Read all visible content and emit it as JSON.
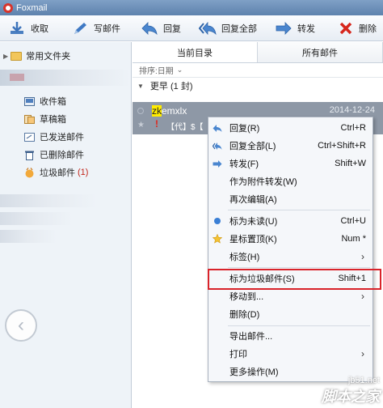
{
  "app": {
    "title": "Foxmail"
  },
  "toolbar": {
    "receive": "收取",
    "compose": "写邮件",
    "reply": "回复",
    "reply_all": "回复全部",
    "forward": "转发",
    "delete": "删除"
  },
  "sidebar": {
    "group_label": "常用文件夹",
    "items": [
      {
        "label": "收件箱",
        "icon": "inbox-icon",
        "count": ""
      },
      {
        "label": "草稿箱",
        "icon": "drafts-icon",
        "count": ""
      },
      {
        "label": "已发送邮件",
        "icon": "sent-icon",
        "count": ""
      },
      {
        "label": "已删除邮件",
        "icon": "trash-icon",
        "count": ""
      },
      {
        "label": "垃圾邮件",
        "icon": "junk-icon",
        "count": "(1)"
      }
    ]
  },
  "main": {
    "tabs": [
      {
        "label": "当前目录"
      },
      {
        "label": "所有邮件"
      }
    ],
    "sort_label": "排序:日期",
    "group_label": "更早 (1 封)",
    "mail": {
      "from_highlight": "zk",
      "from_rest": "emxlx",
      "date": "2014-12-24",
      "subject": "【代】$【"
    }
  },
  "context_menu": {
    "items": [
      {
        "label": "回复(R)",
        "shortcut": "Ctrl+R"
      },
      {
        "label": "回复全部(L)",
        "shortcut": "Ctrl+Shift+R"
      },
      {
        "label": "转发(F)",
        "shortcut": "Shift+W"
      },
      {
        "label": "作为附件转发(W)",
        "shortcut": ""
      },
      {
        "label": "再次编辑(A)",
        "shortcut": ""
      },
      {
        "label": "标为未读(U)",
        "shortcut": "Ctrl+U"
      },
      {
        "label": "星标置顶(K)",
        "shortcut": "Num *"
      },
      {
        "label": "标签(H)",
        "shortcut": ""
      },
      {
        "label": "标为垃圾邮件(S)",
        "shortcut": "Shift+1"
      },
      {
        "label": "移动到...",
        "shortcut": ""
      },
      {
        "label": "删除(D)",
        "shortcut": ""
      },
      {
        "label": "导出邮件...",
        "shortcut": ""
      },
      {
        "label": "打印",
        "shortcut": ""
      },
      {
        "label": "更多操作(M)",
        "shortcut": ""
      }
    ]
  },
  "watermark": {
    "line1": "jb51.net",
    "line2": "脚本之家"
  },
  "colors": {
    "accent": "#5e82ad",
    "selection": "#8e98a6",
    "highlight_box": "#d9232a"
  }
}
